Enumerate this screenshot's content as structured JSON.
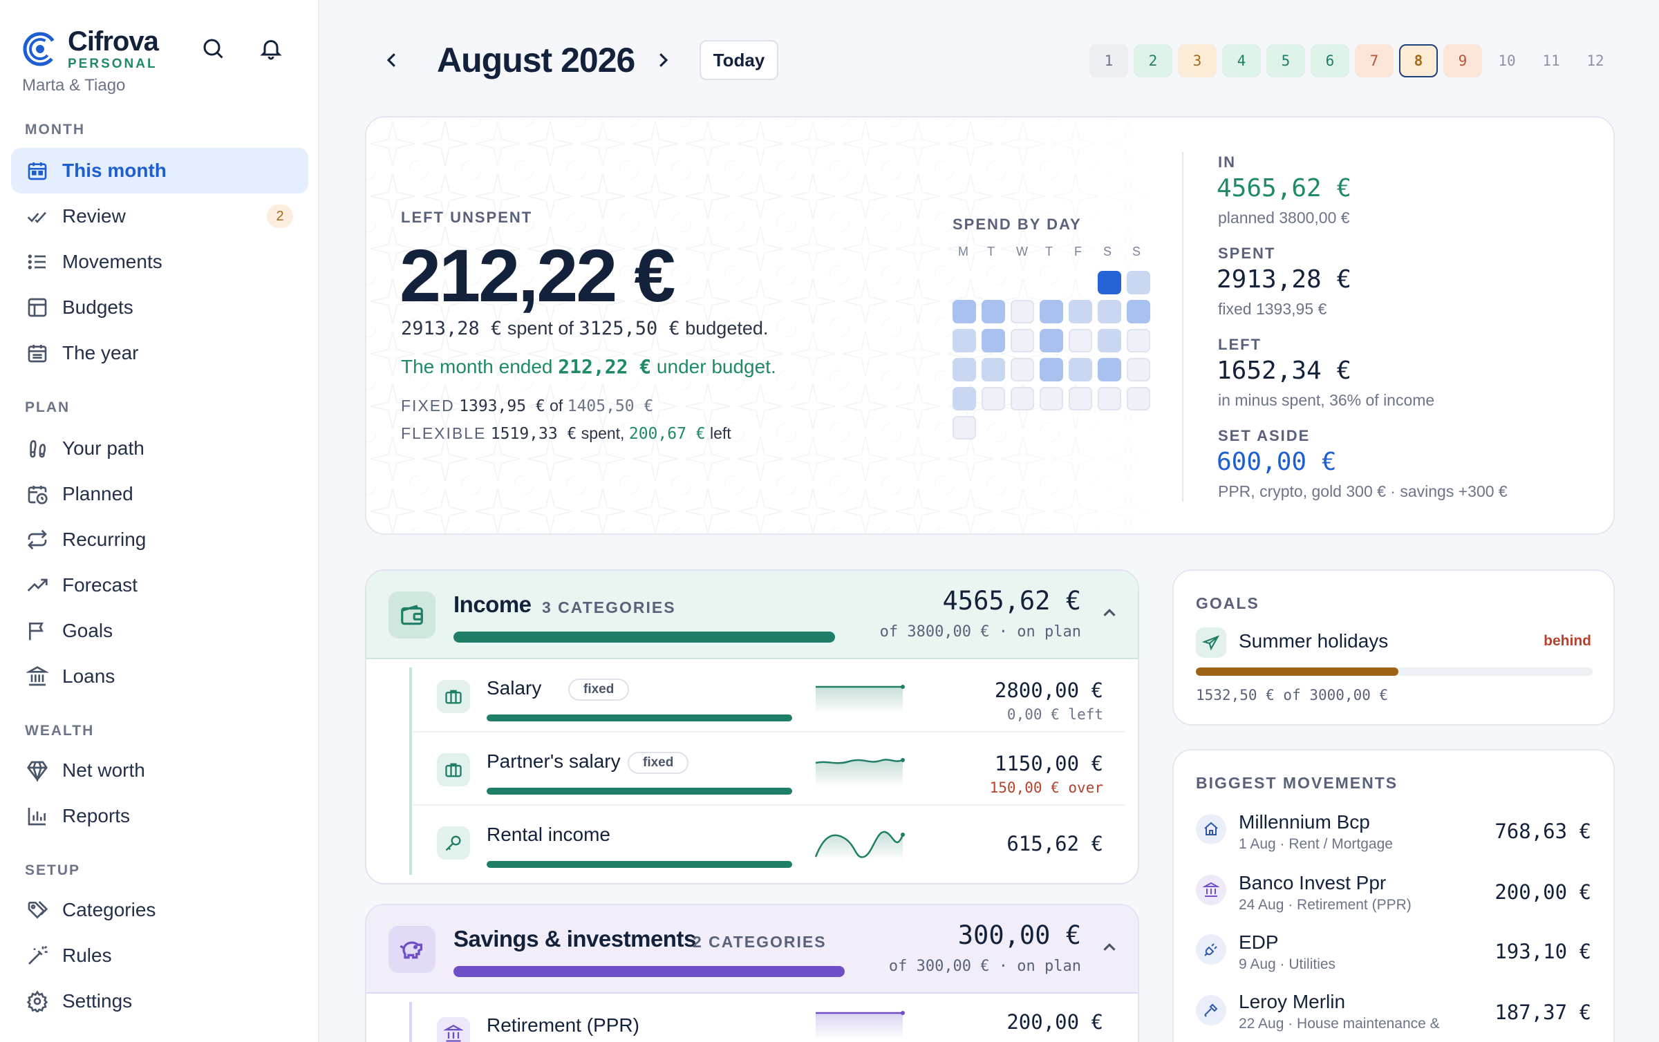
{
  "brand": {
    "name": "Cifrova",
    "subtitle": "PERSONAL",
    "owner": "Marta & Tiago"
  },
  "sidebar": {
    "sections": [
      {
        "label": "MONTH",
        "items": [
          {
            "label": "This month",
            "icon": "calendar-icon",
            "active": true
          },
          {
            "label": "Review",
            "icon": "check-double-icon",
            "badge": "2"
          },
          {
            "label": "Movements",
            "icon": "list-icon"
          },
          {
            "label": "Budgets",
            "icon": "table-icon"
          },
          {
            "label": "The year",
            "icon": "calendar-grid-icon"
          }
        ]
      },
      {
        "label": "PLAN",
        "items": [
          {
            "label": "Your path",
            "icon": "footprints-icon"
          },
          {
            "label": "Planned",
            "icon": "calendar-clock-icon"
          },
          {
            "label": "Recurring",
            "icon": "repeat-icon"
          },
          {
            "label": "Forecast",
            "icon": "trending-up-icon"
          },
          {
            "label": "Goals",
            "icon": "flag-icon"
          },
          {
            "label": "Loans",
            "icon": "bank-icon"
          }
        ]
      },
      {
        "label": "WEALTH",
        "items": [
          {
            "label": "Net worth",
            "icon": "gem-icon"
          },
          {
            "label": "Reports",
            "icon": "bar-chart-icon"
          }
        ]
      },
      {
        "label": "SETUP",
        "items": [
          {
            "label": "Categories",
            "icon": "tags-icon"
          },
          {
            "label": "Rules",
            "icon": "wand-icon"
          },
          {
            "label": "Settings",
            "icon": "gear-icon"
          }
        ]
      }
    ]
  },
  "header": {
    "month_title": "August 2026",
    "today_label": "Today",
    "months": [
      "1",
      "2",
      "3",
      "4",
      "5",
      "6",
      "7",
      "8",
      "9",
      "10",
      "11",
      "12"
    ],
    "selected_month": "8"
  },
  "hero": {
    "left_label": "LEFT UNSPENT",
    "amount": "212,22 €",
    "spent_num": "2913,28 €",
    "spent_text": "spent of",
    "budget_num": "3125,50 €",
    "budget_text": "budgeted.",
    "ended_pre": "The month ended",
    "ended_num": "212,22 €",
    "ended_post": "under budget.",
    "fixed_label": "FIXED",
    "fixed_num": "1393,95 €",
    "fixed_of": "of",
    "fixed_total": "1405,50 €",
    "flex_label": "FLEXIBLE",
    "flex_num": "1519,33 €",
    "flex_spent": "spent,",
    "flex_left_num": "200,67 €",
    "flex_left": "left",
    "spend_by_day_label": "SPEND BY DAY",
    "weekdays": [
      "M",
      "T",
      "W",
      "T",
      "F",
      "S",
      "S"
    ],
    "spend_by_day": [
      0,
      0,
      0,
      0,
      0,
      5,
      2,
      3,
      3,
      1,
      3,
      2,
      2,
      3,
      2,
      3,
      1,
      3,
      1,
      2,
      1,
      2,
      2,
      1,
      3,
      2,
      3,
      1,
      2,
      1,
      1,
      1,
      1,
      1,
      1,
      1
    ],
    "stats": {
      "in_label": "IN",
      "in_value": "4565,62 €",
      "in_sub": "planned 3800,00 €",
      "spent_label": "SPENT",
      "spent_value": "2913,28 €",
      "spent_sub": "fixed 1393,95 €",
      "left_label": "LEFT",
      "left_value": "1652,34 €",
      "left_sub": "in minus spent, 36% of income",
      "aside_label": "SET ASIDE",
      "aside_value": "600,00 €",
      "aside_sub": "PPR, crypto, gold 300 € · savings +300 €"
    }
  },
  "income": {
    "title": "Income",
    "count": "3 CATEGORIES",
    "amount": "4565,62 €",
    "plan": "of 3800,00 € · on plan",
    "progress": 1.0,
    "rows": [
      {
        "name": "Salary",
        "tag": "fixed",
        "amount": "2800,00 €",
        "sub": "0,00 € left",
        "sub_kind": "muted",
        "progress": 1.0,
        "icon": "briefcase-icon"
      },
      {
        "name": "Partner's salary",
        "tag": "fixed",
        "amount": "1150,00 €",
        "sub": "150,00 € over",
        "sub_kind": "red",
        "progress": 1.0,
        "icon": "briefcase-icon"
      },
      {
        "name": "Rental income",
        "tag": "",
        "amount": "615,62 €",
        "sub": "",
        "sub_kind": "muted",
        "progress": 1.0,
        "icon": "key-icon"
      }
    ]
  },
  "savings": {
    "title": "Savings & investments",
    "count": "2 CATEGORIES",
    "amount": "300,00 €",
    "plan": "of 300,00 € · on plan",
    "progress": 1.0,
    "rows": [
      {
        "name": "Retirement (PPR)",
        "amount": "200,00 €",
        "icon": "bank-icon"
      }
    ]
  },
  "goals": {
    "label": "GOALS",
    "name": "Summer holidays",
    "status": "behind",
    "progress": 0.51,
    "sub": "1532,50 € of 3000,00 €",
    "icon": "plane-icon"
  },
  "movements": {
    "label": "BIGGEST MOVEMENTS",
    "items": [
      {
        "name": "Millennium Bcp",
        "sub": "1 Aug · Rent / Mortgage",
        "amount": "768,63 €",
        "icon": "home-icon"
      },
      {
        "name": "Banco Invest Ppr",
        "sub": "24 Aug · Retirement (PPR)",
        "amount": "200,00 €",
        "icon": "bank-icon"
      },
      {
        "name": "EDP",
        "sub": "9 Aug · Utilities",
        "amount": "193,10 €",
        "icon": "plug-icon"
      },
      {
        "name": "Leroy Merlin",
        "sub": "22 Aug · House maintenance &",
        "amount": "187,37 €",
        "icon": "hammer-icon"
      }
    ]
  },
  "colors": {
    "accent": "#1d5fd0",
    "income": "#1f7f66",
    "savings": "#6f4fc7",
    "goal": "#9c6414"
  }
}
